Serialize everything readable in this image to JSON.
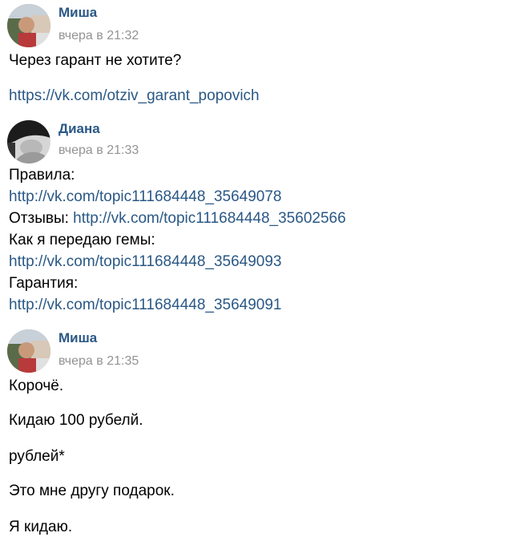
{
  "messages": [
    {
      "author": "Миша",
      "time": "вчера в 21:32",
      "lines": [
        {
          "text": "Через гарант не хотите?"
        },
        {
          "link": "https://vk.com/otziv_garant_popovich"
        }
      ]
    },
    {
      "author": "Диана",
      "time": "вчера в 21:33",
      "lines": [
        {
          "text": "Правила:"
        },
        {
          "link": "http://vk.com/topic111684448_35649078"
        },
        {
          "text": "Отзывы: ",
          "link": "http://vk.com/topic111684448_35602566"
        },
        {
          "text": "Как я передаю гемы:"
        },
        {
          "link": "http://vk.com/topic111684448_35649093"
        },
        {
          "text": "Гарантия:"
        },
        {
          "link": "http://vk.com/topic111684448_35649091"
        }
      ]
    },
    {
      "author": "Миша",
      "time": "вчера в 21:35",
      "lines": [
        {
          "text": "Корочё."
        },
        {
          "text": "Кидаю 100 рубелй."
        },
        {
          "text": "рублей*"
        },
        {
          "text": "Это мне другу подарок."
        },
        {
          "text": "Я кидаю."
        }
      ]
    }
  ],
  "colors": {
    "author": "#2a5885",
    "link": "#2a5885",
    "time": "#939393",
    "text": "#000000"
  }
}
